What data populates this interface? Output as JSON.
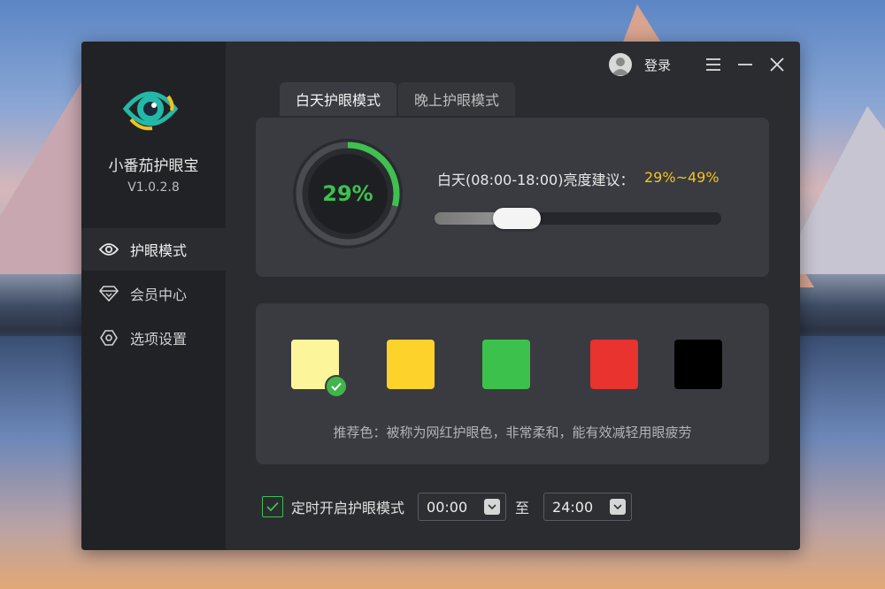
{
  "app": {
    "name": "小番茄护眼宝",
    "version": "V1.0.2.8"
  },
  "sidebar": {
    "items": [
      {
        "label": "护眼模式",
        "icon": "eye-icon",
        "active": true
      },
      {
        "label": "会员中心",
        "icon": "diamond-icon",
        "active": false
      },
      {
        "label": "选项设置",
        "icon": "hexagon-settings-icon",
        "active": false
      }
    ]
  },
  "topbar": {
    "login_label": "登录",
    "icons": [
      "avatar-icon",
      "menu-icon",
      "minimize-icon",
      "close-icon"
    ]
  },
  "tabs": [
    {
      "label": "白天护眼模式",
      "active": true
    },
    {
      "label": "晚上护眼模式",
      "active": false
    }
  ],
  "brightness": {
    "percent_text": "29%",
    "percent": 29,
    "label": "白天(08:00-18:00)亮度建议：",
    "range_text": "29%~49%",
    "slider_value": 0.29,
    "gauge_color": "#3fc04f",
    "range_color": "#f5c41b"
  },
  "colors": {
    "swatches": [
      {
        "name": "light-yellow",
        "hex": "#fdf59a",
        "selected": true
      },
      {
        "name": "yellow",
        "hex": "#fdd22b",
        "selected": false
      },
      {
        "name": "green",
        "hex": "#3cc24c",
        "selected": false
      },
      {
        "name": "red",
        "hex": "#e8332e",
        "selected": false
      },
      {
        "name": "black",
        "hex": "#000000",
        "selected": false
      }
    ],
    "tip": "推荐色：被称为网红护眼色，非常柔和，能有效减轻用眼疲劳"
  },
  "schedule": {
    "checkbox_label": "定时开启护眼模式",
    "checked": true,
    "start": "00:00",
    "to_label": "至",
    "end": "24:00"
  }
}
